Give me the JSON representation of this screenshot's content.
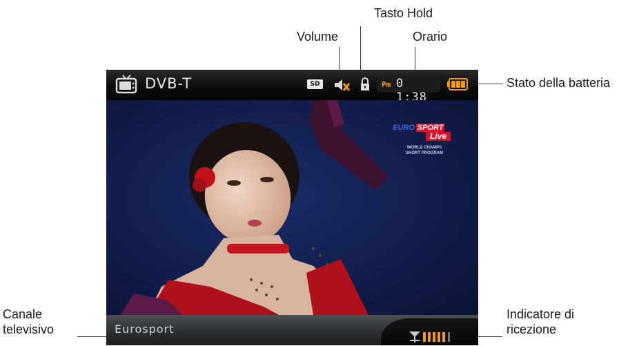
{
  "device": {
    "app_title": "DVB-T",
    "sd_badge": "SD",
    "clock_ampm": "Pm",
    "clock_time": "0 1:38",
    "channel_name": "Eurosport",
    "overlay": {
      "brand_top": "EURO",
      "brand_sport": "SPORT",
      "brand_live": "Live",
      "caption_1": "WORLD CHAMPS",
      "caption_2": "SHORT PROGRAM"
    },
    "volume_muted": true,
    "battery_bars": 3,
    "signal_bars": 5,
    "icons": [
      "tv-icon",
      "sd-icon",
      "volume-muted-icon",
      "hold-lock-icon",
      "battery-icon",
      "signal-icon"
    ],
    "colors": {
      "accent": "#f39a1e",
      "bar": "#0d0d0d"
    }
  },
  "callouts": {
    "tasto_hold": "Tasto Hold",
    "volume": "Volume",
    "orario": "Orario",
    "stato_batteria": "Stato della batteria",
    "canale_1": "Canale",
    "canale_2": "televisivo",
    "indicatore_1": "Indicatore di",
    "indicatore_2": "ricezione"
  }
}
